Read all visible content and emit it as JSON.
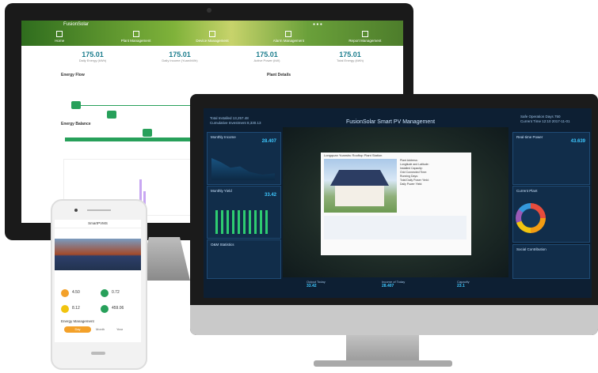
{
  "back_screen": {
    "app_name": "FusionSolar",
    "nav_items": [
      "Home",
      "Plant Management",
      "Device Management",
      "Alarm Management",
      "Report Management"
    ],
    "stats": [
      {
        "value": "175.01",
        "label": "Daily Energy (kWh)"
      },
      {
        "value": "175.01",
        "label": "Daily Income (Yuan/kWh)"
      },
      {
        "value": "175.01",
        "label": "Active Power (kW)"
      },
      {
        "value": "175.01",
        "label": "Total Energy (kWh)"
      }
    ],
    "energy_flow_title": "Energy Flow",
    "plant_details_title": "Plant Details",
    "energy_balance_title": "Energy Balance"
  },
  "front_screen": {
    "title": "FusionSolar Smart PV Management",
    "top_left": [
      "Total Installed 13,257.48",
      "Cumulative Investment 8,330.13"
    ],
    "top_right": [
      "Safe Operation Days 750",
      "Current Time 12:10 2017-11-01"
    ],
    "panels_left": [
      {
        "title": "Monthly Income",
        "value": "28.407"
      },
      {
        "title": "Monthly Yield",
        "value": "33.42"
      },
      {
        "title": "O&M Statistics",
        "value": ""
      }
    ],
    "panels_right": [
      {
        "title": "Real-time Power",
        "value": "43.639"
      },
      {
        "title": "Current Plant",
        "value": ""
      },
      {
        "title": "Social Contribution",
        "value": ""
      }
    ],
    "popup_title": "Longquan Yuanshu Rooftop Plant Station",
    "popup_info": [
      "Plant Address:",
      "Longitude and Latitude:",
      "Installed Capacity:",
      "Grid Connected Time:",
      "Running Days:",
      "Total Daily Power Yield:",
      "Daily Power Yield:"
    ],
    "bottom_stats": [
      {
        "label": "Output Today",
        "value": "33.42"
      },
      {
        "label": "Income of Today",
        "value": "28.407"
      },
      {
        "label": "Capacity",
        "value": "23.1"
      }
    ]
  },
  "phone": {
    "title": "SmartPVMS",
    "kpis": [
      "4.50",
      "0.72",
      "8.12",
      "459.06"
    ],
    "section": "Energy Management",
    "tabs": [
      "Day",
      "Month",
      "Year"
    ]
  }
}
